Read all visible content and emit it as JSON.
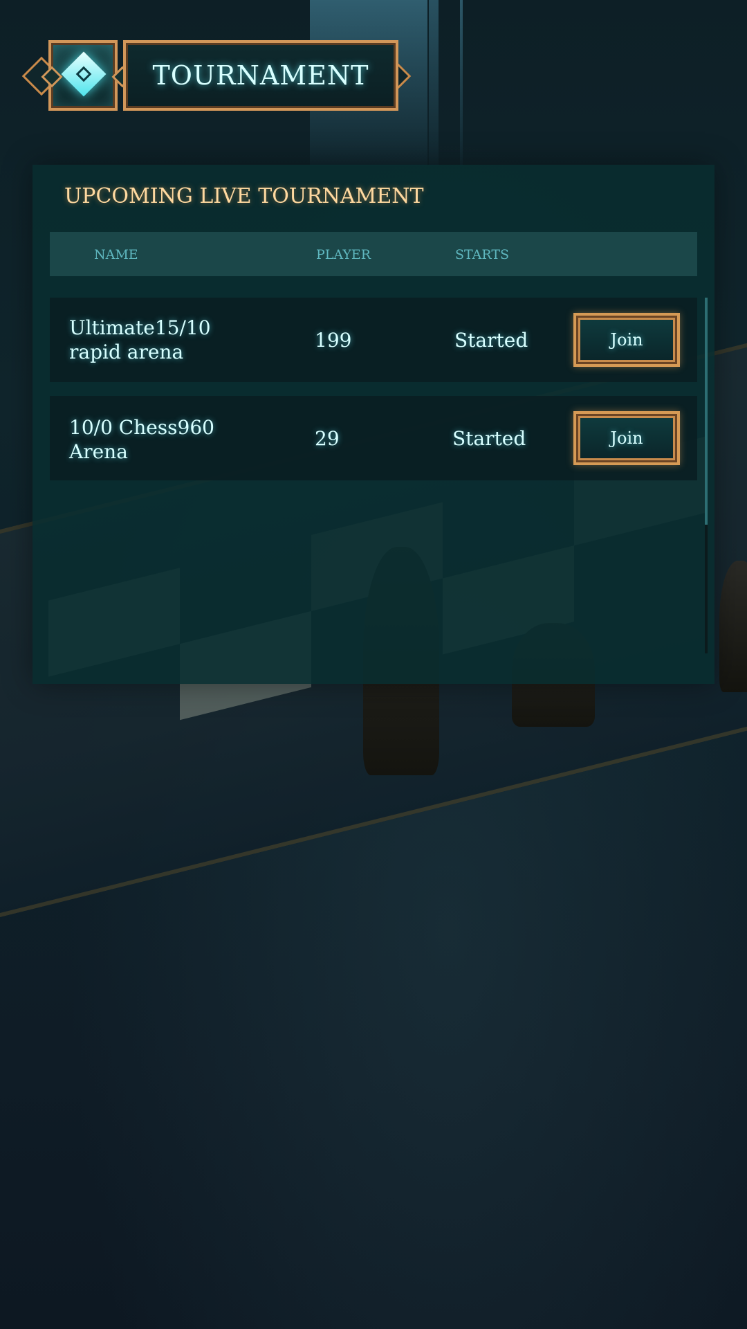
{
  "header": {
    "title": "TOURNAMENT",
    "icon": "tournament-logo-icon"
  },
  "panel": {
    "heading": "UPCOMING LIVE TOURNAMENT",
    "columns": [
      "NAME",
      "PLAYER",
      "STARTS"
    ],
    "rows": [
      {
        "name_line1": "Ultimate15/10",
        "name_line2": "rapid arena",
        "players": "199",
        "starts": "Started",
        "action": "Join"
      },
      {
        "name_line1": "10/0 Chess960",
        "name_line2": "Arena",
        "players": "29",
        "starts": "Started",
        "action": "Join"
      }
    ]
  },
  "colors": {
    "accent_gold": "#d69a55",
    "accent_cyan": "#d8ffff",
    "heading_gold": "#ffd9a0",
    "column_header": "#5fb7bf"
  }
}
